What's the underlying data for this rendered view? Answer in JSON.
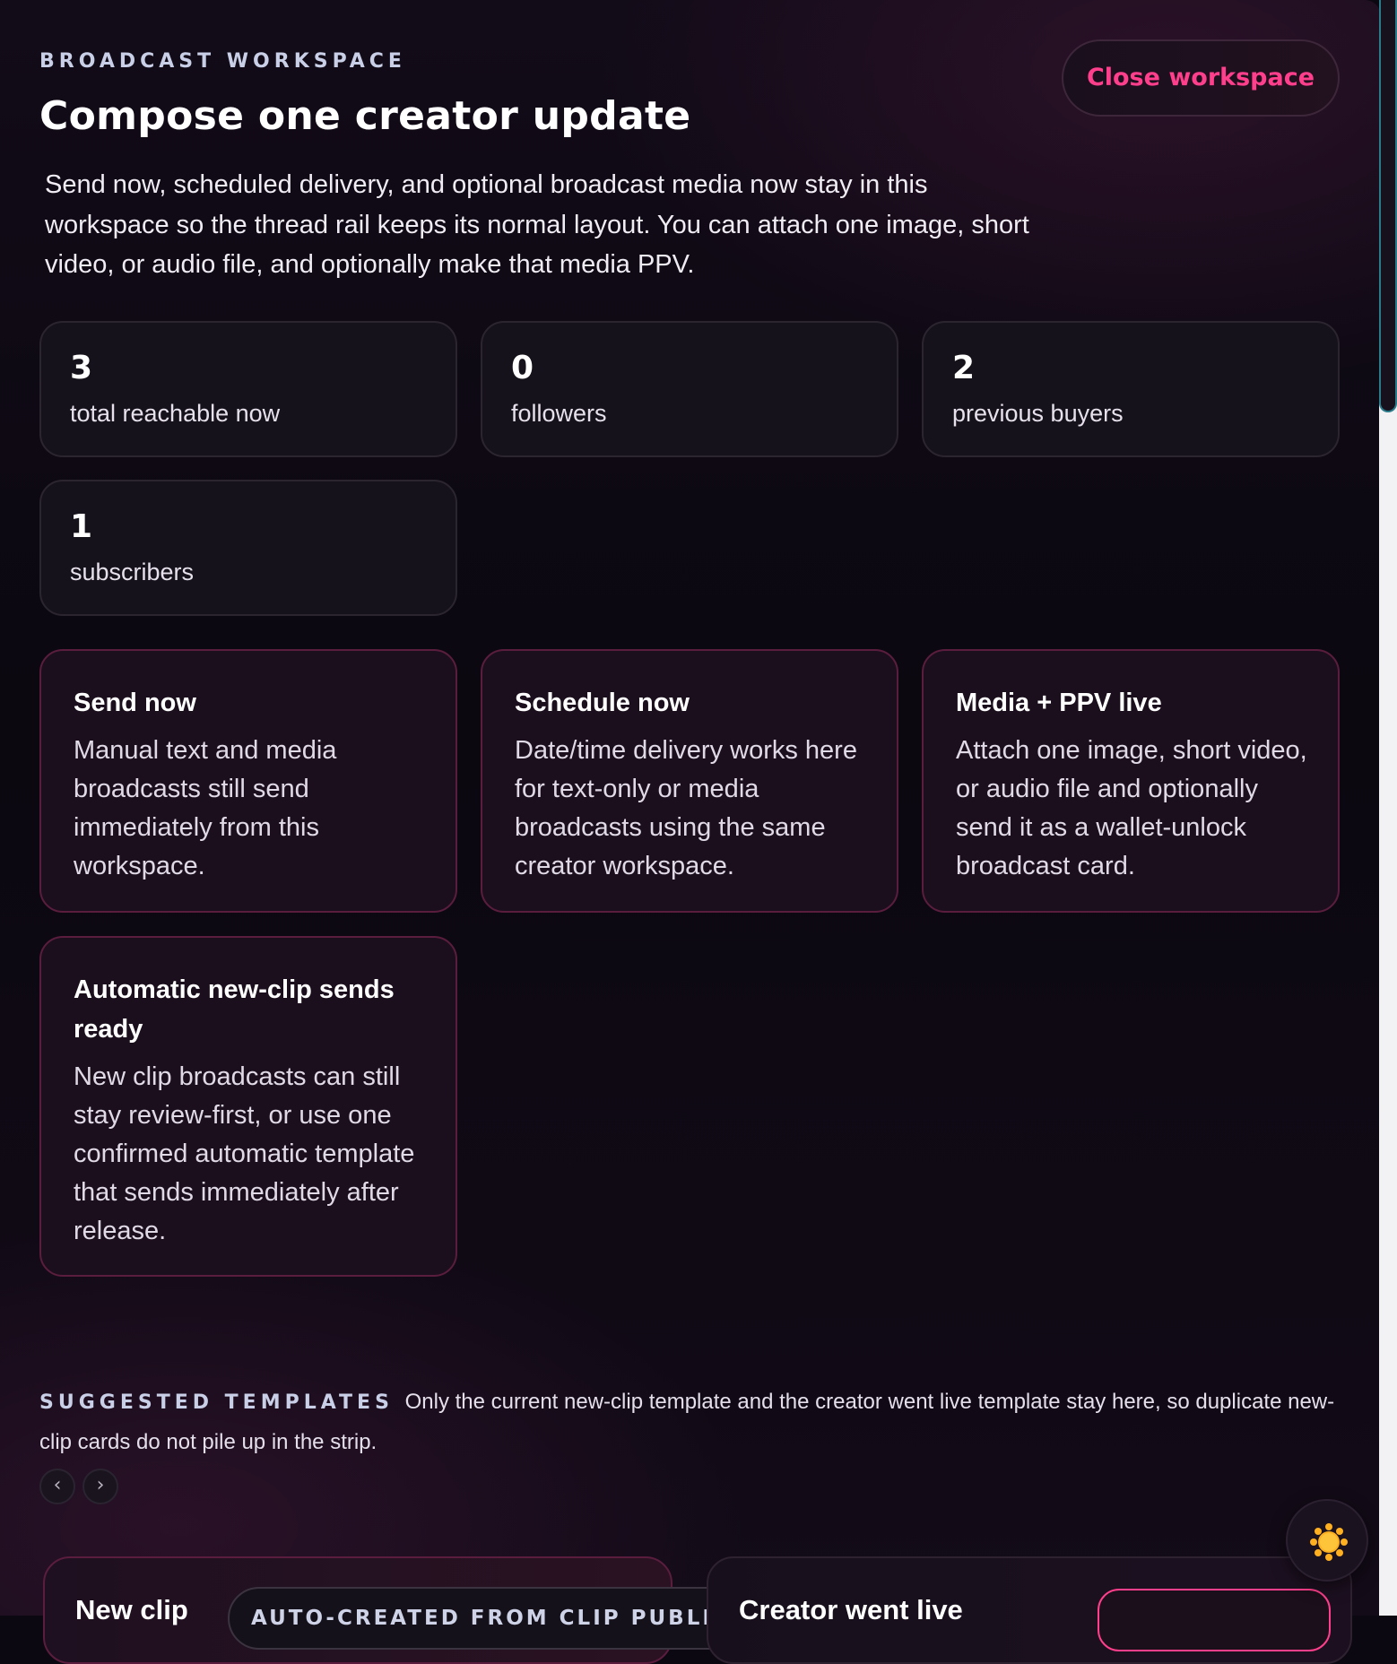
{
  "header": {
    "eyebrow": "BROADCAST WORKSPACE",
    "title": "Compose one creator update",
    "intro": "Send now, scheduled delivery, and optional broadcast media now stay in this workspace so the thread rail keeps its normal layout. You can attach one image, short video, or audio file, and optionally make that media PPV.",
    "close_label": "Close workspace"
  },
  "stats": [
    {
      "value": "3",
      "label": "total reachable now"
    },
    {
      "value": "0",
      "label": "followers"
    },
    {
      "value": "2",
      "label": "previous buyers"
    },
    {
      "value": "1",
      "label": "subscribers"
    }
  ],
  "features": [
    {
      "title": "Send now",
      "body": "Manual text and media broadcasts still send immediately from this workspace."
    },
    {
      "title": "Schedule now",
      "body": "Date/time delivery works here for text-only or media broadcasts using the same creator workspace."
    },
    {
      "title": "Media + PPV live",
      "body": "Attach one image, short video, or audio file and optionally send it as a wallet-unlock broadcast card."
    },
    {
      "title": "Automatic new-clip sends ready",
      "body": "New clip broadcasts can still stay review-first, or use one confirmed automatic template that sends immediately after release."
    }
  ],
  "templates": {
    "kicker": "SUGGESTED TEMPLATES",
    "description": "Only the current new-clip template and the creator went live template stay here, so duplicate new-clip cards do not pile up in the strip.",
    "prev_label": "‹",
    "next_label": "›",
    "cards": [
      {
        "title": "New clip",
        "badge": "AUTO-CREATED FROM CLIP PUBLISH"
      },
      {
        "title": "Creator went live"
      }
    ]
  },
  "colors": {
    "accent": "#ff3f8c",
    "background": "#0c0812",
    "feature_border": "#5a1d3e",
    "sun_icon": "#ffb020"
  },
  "icons": {
    "theme_toggle": "sun-icon"
  }
}
